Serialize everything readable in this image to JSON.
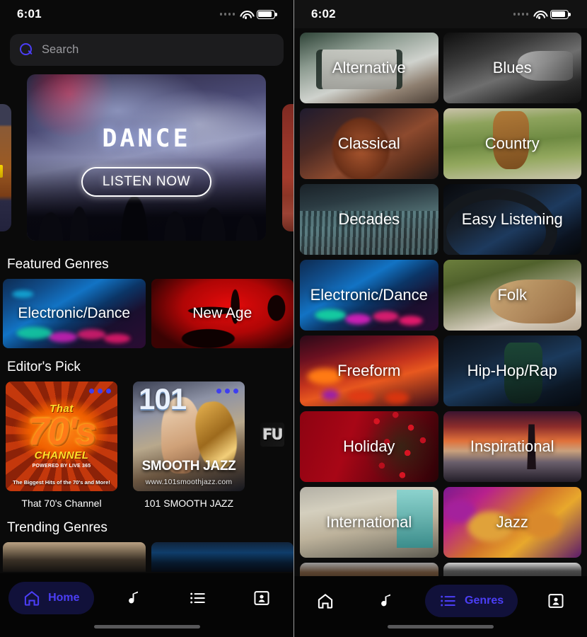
{
  "left_screen": {
    "status_bar": {
      "time": "6:01",
      "cellular_icon": "cellular-dots-icon",
      "wifi_icon": "wifi-icon",
      "battery_icon": "battery-icon"
    },
    "search": {
      "placeholder": "Search",
      "value": "",
      "icon": "search-icon"
    },
    "hero": {
      "title": "DANCE",
      "button_label": "LISTEN NOW",
      "prev_peek": "peek-card-previous",
      "next_peek": "peek-card-next"
    },
    "sections": [
      {
        "title": "Featured Genres"
      },
      {
        "title": "Editor's Pick"
      },
      {
        "title": "Trending Genres"
      }
    ],
    "featured_genres": [
      {
        "label": "Electronic/Dance",
        "bg_class": "bg-electronic"
      },
      {
        "label": "New Age",
        "bg_class": "bg-newage"
      }
    ],
    "editors_pick": [
      {
        "label": "That 70's Channel",
        "art": {
          "number": "70's",
          "word_top": "That",
          "word_mid": "CHANNEL",
          "powered_by": "POWERED BY LIVE 365",
          "tagline": "The Biggest Hits of the 70's and More!"
        },
        "dots_icon": "more-options-dots-icon"
      },
      {
        "label": "101 SMOOTH JAZZ",
        "art": {
          "number": "101",
          "name": "SMOOTH JAZZ",
          "url": "www.101smoothjazz.com"
        },
        "dots_icon": "more-options-dots-icon"
      }
    ],
    "editors_pick_peek": {
      "label": "FU"
    },
    "trending_genres": [
      {
        "label": "",
        "bg_class": "trend-a"
      },
      {
        "label": "",
        "bg_class": "trend-b"
      }
    ],
    "tabs": [
      {
        "label": "Home",
        "icon": "home-icon",
        "active": true
      },
      {
        "label": "",
        "icon": "music-note-icon",
        "active": false
      },
      {
        "label": "",
        "icon": "list-icon",
        "active": false
      },
      {
        "label": "",
        "icon": "profile-card-icon",
        "active": false
      }
    ]
  },
  "right_screen": {
    "status_bar": {
      "time": "6:02",
      "cellular_icon": "cellular-dots-icon",
      "wifi_icon": "wifi-icon",
      "battery_icon": "battery-icon"
    },
    "genres": [
      {
        "label": "Alternative",
        "bg_class": "g-alternative"
      },
      {
        "label": "Blues",
        "bg_class": "g-blues"
      },
      {
        "label": "Classical",
        "bg_class": "g-classical"
      },
      {
        "label": "Country",
        "bg_class": "g-country"
      },
      {
        "label": "Decades",
        "bg_class": "g-decades"
      },
      {
        "label": "Easy Listening",
        "bg_class": "g-easy"
      },
      {
        "label": "Electronic/Dance",
        "bg_class": "g-electronic2"
      },
      {
        "label": "Folk",
        "bg_class": "g-folk"
      },
      {
        "label": "Freeform",
        "bg_class": "g-freeform"
      },
      {
        "label": "Hip-Hop/Rap",
        "bg_class": "g-hiphop"
      },
      {
        "label": "Holiday",
        "bg_class": "g-holiday"
      },
      {
        "label": "Inspirational",
        "bg_class": "g-inspirational"
      },
      {
        "label": "International",
        "bg_class": "g-international"
      },
      {
        "label": "Jazz",
        "bg_class": "g-jazz"
      }
    ],
    "genres_cut_off": [
      {
        "label": "",
        "bg_class": "g-cut-a"
      },
      {
        "label": "",
        "bg_class": "g-cut-b"
      }
    ],
    "tabs": [
      {
        "label": "",
        "icon": "home-icon",
        "active": false
      },
      {
        "label": "",
        "icon": "music-note-icon",
        "active": false
      },
      {
        "label": "Genres",
        "icon": "list-icon",
        "active": true
      },
      {
        "label": "",
        "icon": "profile-card-icon",
        "active": false
      }
    ]
  },
  "theme": {
    "accent": "#4b3ef5",
    "active_pill_bg": "#11113a",
    "background": "#0a0a0a",
    "search_bg": "#1c1c1e",
    "text_primary": "#ffffff",
    "text_secondary": "#9a9a9e"
  }
}
